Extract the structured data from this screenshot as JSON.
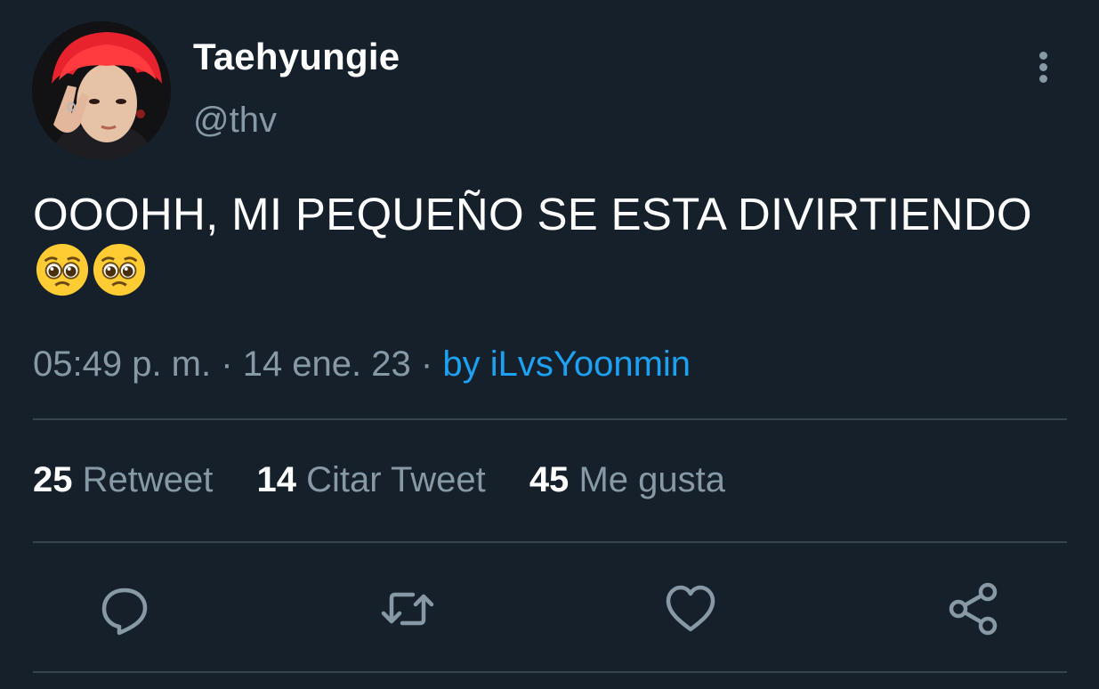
{
  "user": {
    "display_name": "Taehyungie",
    "handle": "@thv"
  },
  "tweet": {
    "text": "OOOHH, MI PEQUEÑO SE ESTA DIVIRTIENDO",
    "emoji": [
      "pleading-face-emoji",
      "pleading-face-emoji"
    ]
  },
  "meta": {
    "time": "05:49 p. m.",
    "separator": "·",
    "date": "14 ene. 23",
    "source": "by iLvsYoonmin"
  },
  "stats": {
    "retweets": {
      "count": "25",
      "label": "Retweet"
    },
    "quotes": {
      "count": "14",
      "label": "Citar Tweet"
    },
    "likes": {
      "count": "45",
      "label": "Me gusta"
    }
  },
  "actions": [
    "reply-icon",
    "retweet-icon",
    "like-icon",
    "share-icon"
  ],
  "colors": {
    "background": "#15202b",
    "secondary_text": "#8899a6",
    "link": "#1da1f2",
    "divider": "#38444d"
  }
}
